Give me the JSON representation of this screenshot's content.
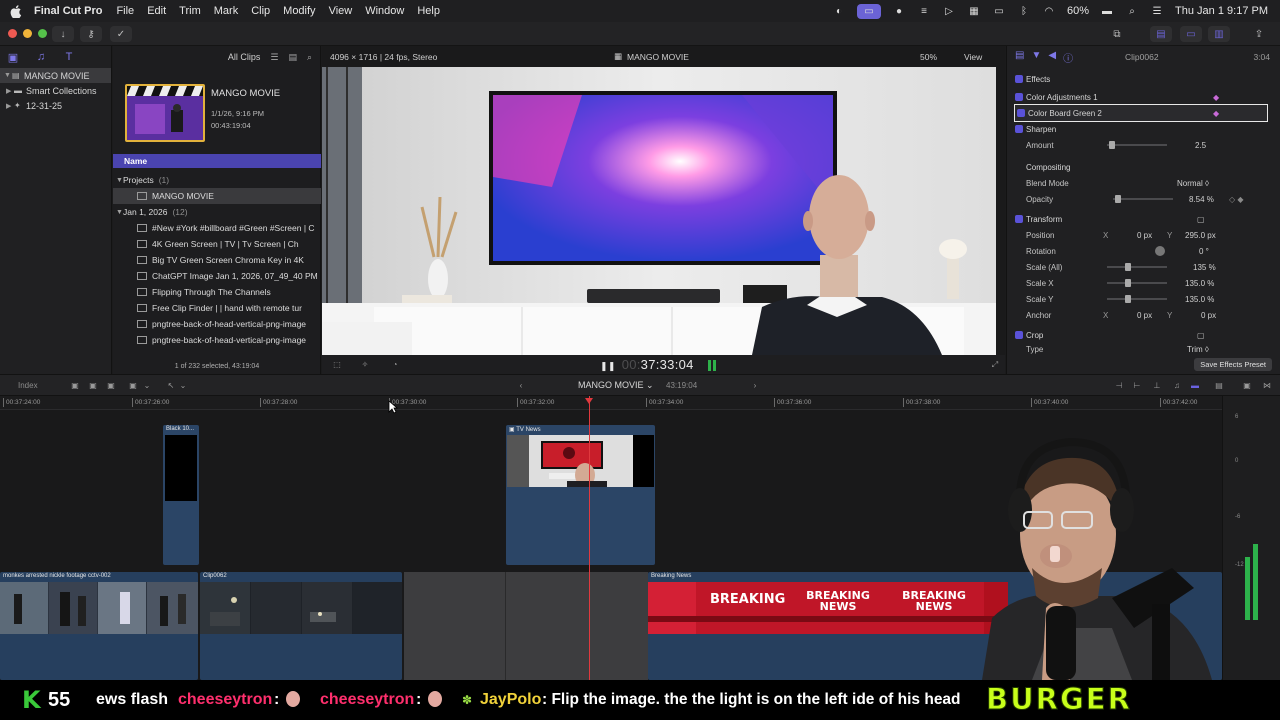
{
  "menubar": {
    "app": "Final Cut Pro",
    "items": [
      "File",
      "Edit",
      "Trim",
      "Mark",
      "Clip",
      "Modify",
      "View",
      "Window",
      "Help"
    ],
    "battery": "60%",
    "clock": "Thu Jan 1  9:17 PM"
  },
  "sidebar": {
    "library": "MANGO MOVIE",
    "items": [
      "Smart Collections",
      "12-31-25"
    ]
  },
  "browser": {
    "filter": "All Clips",
    "project_name": "MANGO MOVIE",
    "project_date": "1/1/26, 9:16 PM",
    "project_duration": "00:43:19:04",
    "column_header": "Name",
    "group_projects": "Projects",
    "group_projects_count": "(1)",
    "project_row": "MANGO MOVIE",
    "group_date": "Jan 1, 2026",
    "group_date_count": "(12)",
    "clips": [
      "#New #York #billboard #Green #Screen | C",
      "4K Green Screen  |  TV  |  Tv Screen  |  Ch",
      "Big TV Green Screen Chroma Key in 4K",
      "ChatGPT Image Jan 1, 2026, 07_49_40 PM",
      "Flipping Through The Channels",
      "Free Clip Finder  |  |  hand with remote tur",
      "pngtree-back-of-head-vertical-png-image",
      "pngtree-back-of-head-vertical-png-image"
    ],
    "footer": "1 of 232 selected, 43:19:04"
  },
  "viewer": {
    "format": "4096 × 1716 | 24 fps, Stereo",
    "title": "MANGO MOVIE",
    "zoom": "50%",
    "view": "View",
    "timecode_dim": "00:",
    "timecode": "37:33:04"
  },
  "inspector": {
    "clip": "Clip0062",
    "duration": "3:04",
    "effects": "Effects",
    "color_adj": "Color Adjustments 1",
    "color_board": "Color Board Green 2",
    "sharpen": "Sharpen",
    "amount_label": "Amount",
    "amount_val": "2.5",
    "compositing": "Compositing",
    "blend_label": "Blend Mode",
    "blend_val": "Normal ◊",
    "opacity_label": "Opacity",
    "opacity_val": "8.54  %",
    "transform": "Transform",
    "position_label": "Position",
    "pos_x_axis": "X",
    "pos_x": "0  px",
    "pos_y_axis": "Y",
    "pos_y": "295.0  px",
    "rotation_label": "Rotation",
    "rotation_val": "0 °",
    "scale_all_label": "Scale (All)",
    "scale_all_val": "135  %",
    "scale_x_label": "Scale X",
    "scale_x_val": "135.0  %",
    "scale_y_label": "Scale Y",
    "scale_y_val": "135.0  %",
    "anchor_label": "Anchor",
    "anchor_x_axis": "X",
    "anchor_x": "0  px",
    "anchor_y_axis": "Y",
    "anchor_y": "0  px",
    "crop": "Crop",
    "type_label": "Type",
    "type_val": "Trim ◊",
    "save_preset": "Save Effects Preset"
  },
  "timeline": {
    "index": "Index",
    "project": "MANGO MOVIE",
    "project_duration": "43:19:04",
    "ruler": [
      "00:37:24:00",
      "00:37:26:00",
      "00:37:28:00",
      "00:37:30:00",
      "00:37:32:00",
      "00:37:34:00",
      "00:37:36:00",
      "00:37:38:00",
      "00:37:40:00",
      "00:37:42:00"
    ],
    "clips": {
      "black": "Black 10...",
      "tvnews": "TV News",
      "cctv": "monkes arrested nickle footage cctv-002",
      "clip0062": "Clip0062",
      "breaking": "Breaking News"
    },
    "breaking_text": [
      "BREAKING",
      "BREAKING NEWS",
      "BREAKING NEWS"
    ]
  },
  "meters": {
    "labels": [
      "6",
      "0",
      "-6",
      "-12"
    ],
    "levels": [
      0.35,
      0.42
    ]
  },
  "ticker": {
    "k": "K",
    "count": "55",
    "flash": "ews flash",
    "user1": "cheeseytron",
    "sep1": ":",
    "user2": "cheeseytron",
    "sep2": ":",
    "user3": "JayPolo",
    "message": ": Flip the image. the the light is on the left ide of his head",
    "brand": "BURGER PLANET"
  },
  "colors": {
    "accent": "#6b63d6",
    "playhead": "#e0393e",
    "clip": "#2b4566",
    "ticker_green": "#c8ff1a"
  }
}
